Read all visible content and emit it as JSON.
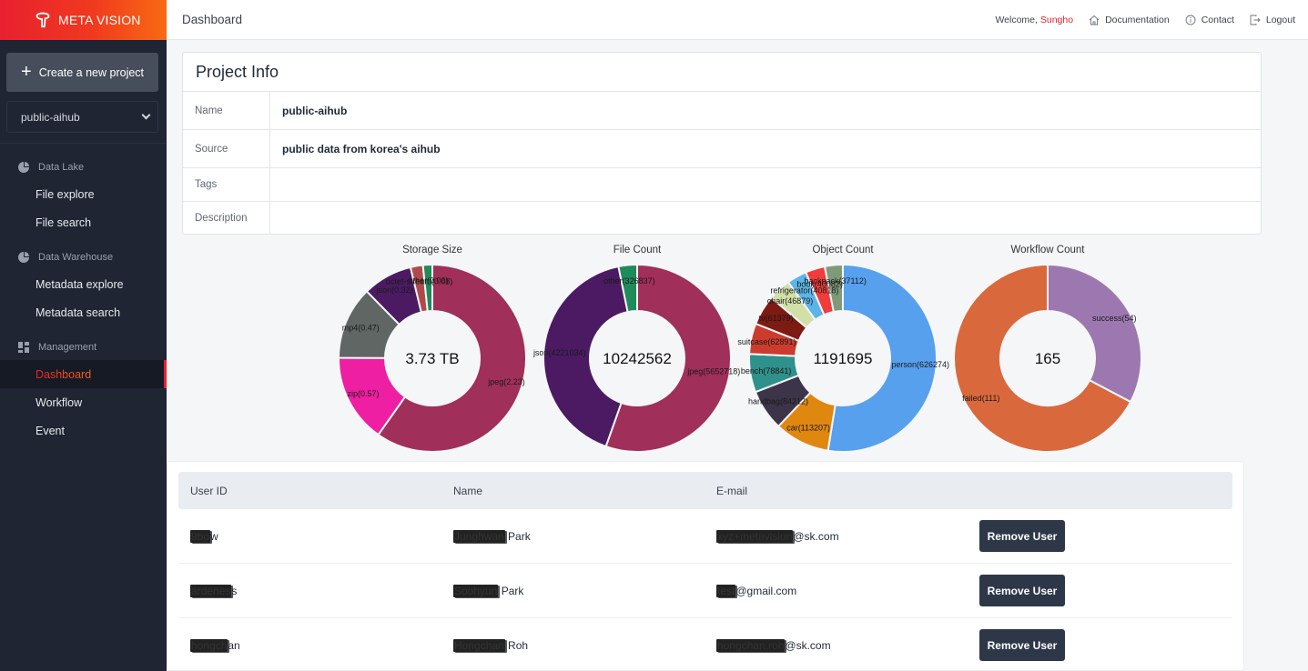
{
  "brand": {
    "name": "META VISION"
  },
  "sidebar": {
    "create_label": "Create a new project",
    "project_selected": "public-aihub",
    "sections": [
      {
        "title": "Data Lake",
        "icon": "pie-chart-icon",
        "items": [
          {
            "label": "File explore"
          },
          {
            "label": "File search"
          }
        ]
      },
      {
        "title": "Data Warehouse",
        "icon": "pie-chart-icon",
        "items": [
          {
            "label": "Metadata explore"
          },
          {
            "label": "Metadata search"
          }
        ]
      },
      {
        "title": "Management",
        "icon": "dashboard-icon",
        "items": [
          {
            "label": "Dashboard",
            "active": true
          },
          {
            "label": "Workflow"
          },
          {
            "label": "Event"
          }
        ]
      }
    ]
  },
  "header": {
    "title": "Dashboard",
    "welcome_prefix": "Welcome, ",
    "user": "Sungho",
    "links": [
      {
        "label": "Documentation",
        "icon": "home-icon"
      },
      {
        "label": "Contact",
        "icon": "info-icon"
      },
      {
        "label": "Logout",
        "icon": "logout-icon"
      }
    ]
  },
  "project_info": {
    "title": "Project Info",
    "rows": [
      {
        "label": "Name",
        "value": "public-aihub"
      },
      {
        "label": "Source",
        "value": "public data from korea's aihub"
      },
      {
        "label": "Tags",
        "value": ""
      },
      {
        "label": "Description",
        "value": ""
      }
    ]
  },
  "chart_data": [
    {
      "type": "pie",
      "title": "Storage Size",
      "center_label": "3.73 TB",
      "unit": "TB",
      "slices": [
        {
          "label": "jpeg",
          "value": 2.23,
          "color": "#a02f5a"
        },
        {
          "label": "zip",
          "value": 0.57,
          "color": "#ee1fa2"
        },
        {
          "label": "mp4",
          "value": 0.47,
          "color": "#5f6664"
        },
        {
          "label": "json",
          "value": 0.32,
          "color": "#4b1a63"
        },
        {
          "label": "octet-stream",
          "value": 0.08,
          "color": "#b04a4a"
        },
        {
          "label": "other",
          "value": 0.06,
          "color": "#1f8a5a"
        }
      ]
    },
    {
      "type": "pie",
      "title": "File Count",
      "center_label": "10242562",
      "slices": [
        {
          "label": "jpeg",
          "value": 5652718,
          "color": "#a02f5a"
        },
        {
          "label": "json",
          "value": 4221034,
          "color": "#4b1a63"
        },
        {
          "label": "other",
          "value": 326837,
          "color": "#1f8a5a"
        }
      ]
    },
    {
      "type": "pie",
      "title": "Object Count",
      "center_label": "1191695",
      "slices": [
        {
          "label": "person",
          "value": 626274,
          "color": "#56a0ee"
        },
        {
          "label": "car",
          "value": 113207,
          "color": "#e0870f"
        },
        {
          "label": "handbag",
          "value": 84212,
          "color": "#3c3449"
        },
        {
          "label": "bench",
          "value": 78841,
          "color": "#2e918b"
        },
        {
          "label": "suitcase",
          "value": 62891,
          "color": "#cb3c2e"
        },
        {
          "label": "tv",
          "value": 61379,
          "color": "#7d1a12"
        },
        {
          "label": "chair",
          "value": 46879,
          "color": "#d2e0a8"
        },
        {
          "label": "refrigerator",
          "value": 40818,
          "color": "#5cb4e8"
        },
        {
          "label": "book",
          "value": 40082,
          "color": "#f03c3a"
        },
        {
          "label": "backpack",
          "value": 37112,
          "color": "#7f9a78"
        }
      ]
    },
    {
      "type": "pie",
      "title": "Workflow Count",
      "center_label": "165",
      "slices": [
        {
          "label": "success",
          "value": 54,
          "color": "#9d78b0"
        },
        {
          "label": "failed",
          "value": 111,
          "color": "#d9693c"
        }
      ]
    }
  ],
  "users": {
    "columns": [
      "User ID",
      "Name",
      "E-mail",
      ""
    ],
    "remove_label": "Remove User",
    "rows": [
      {
        "id_hidden": "9bo",
        "id_visible": "w",
        "name_hidden": "Junghwan",
        "name_visible": " Park",
        "email_hidden": "xyz+metavision",
        "email_visible": "@sk.com"
      },
      {
        "id_hidden": "ardenes",
        "id_visible": "s",
        "name_hidden": "Soohyun",
        "name_visible": " Park",
        "email_hidden": "test",
        "email_visible": "@gmail.com"
      },
      {
        "id_hidden": "hongch",
        "id_visible": "an",
        "name_hidden": "Hongchan",
        "name_visible": " Roh",
        "email_hidden": "hongchan.roh",
        "email_visible": "@sk.com"
      }
    ]
  }
}
